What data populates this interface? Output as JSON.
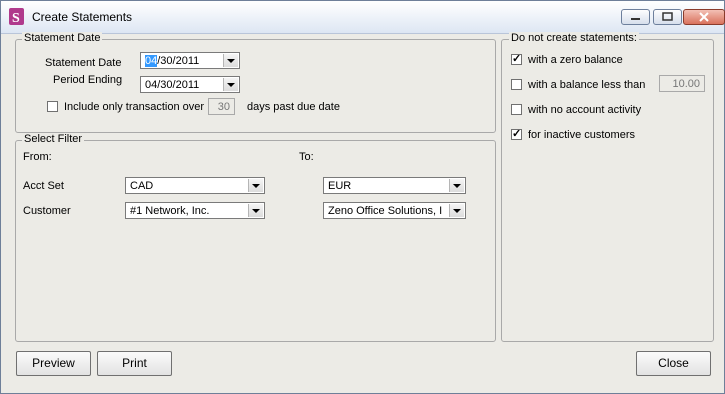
{
  "window": {
    "title": "Create Statements",
    "controls": {
      "minimize": "minimize-icon",
      "maximize": "maximize-icon",
      "close": "close-icon"
    }
  },
  "statement_date_group": {
    "legend": "Statement Date",
    "statement_date_label": "Statement Date",
    "statement_date_selected": "04",
    "statement_date_rest": "/30/2011",
    "period_ending_label": "Period Ending",
    "period_ending_value": "04/30/2011",
    "include_only_label": "Include only transaction over",
    "include_only_checked": false,
    "days_value": "30",
    "days_suffix": "days past due date"
  },
  "select_filter": {
    "legend": "Select Filter",
    "from_label": "From:",
    "to_label": "To:",
    "acct_set_label": "Acct Set",
    "acct_set_from": "CAD",
    "acct_set_to": "EUR",
    "customer_label": "Customer",
    "customer_from": "#1 Network, Inc.",
    "customer_to": "Zeno Office Solutions, I"
  },
  "do_not_create": {
    "legend": "Do not create statements:",
    "options": [
      {
        "label": "with a zero balance",
        "checked": true
      },
      {
        "label": "with a balance less than",
        "checked": false
      },
      {
        "label": "with no account activity",
        "checked": false
      },
      {
        "label": "for inactive customers",
        "checked": true
      }
    ],
    "balance_threshold": "10.00"
  },
  "buttons": {
    "preview": "Preview",
    "print": "Print",
    "close": "Close"
  }
}
